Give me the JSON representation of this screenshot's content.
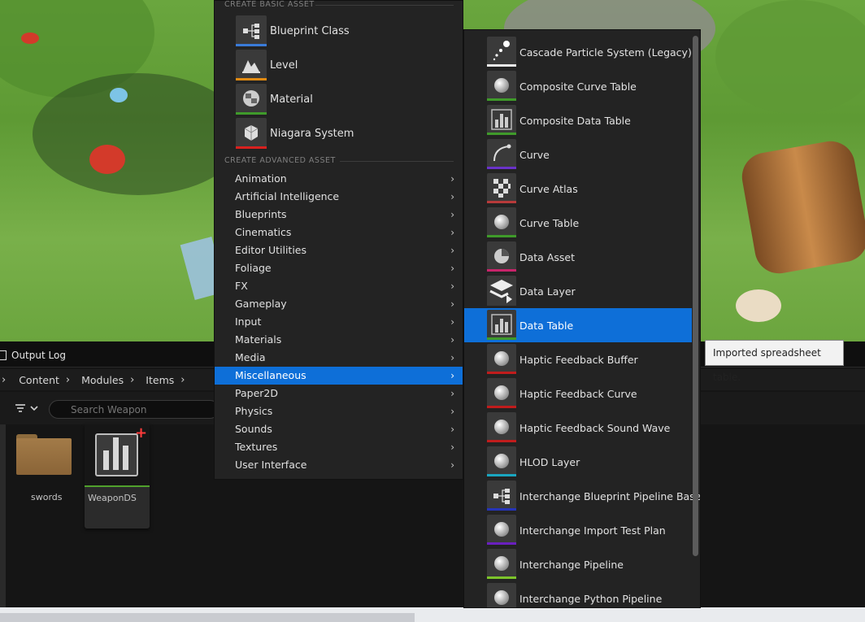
{
  "menu": {
    "section_basic": "CREATE BASIC ASSET",
    "section_advanced": "CREATE ADVANCED ASSET",
    "basic_items": [
      {
        "label": "Blueprint Class",
        "icon": "blueprint-icon",
        "color": "#3a7bd8"
      },
      {
        "label": "Level",
        "icon": "level-icon",
        "color": "#e08a12"
      },
      {
        "label": "Material",
        "icon": "material-icon",
        "color": "#3f9a2a"
      },
      {
        "label": "Niagara System",
        "icon": "niagara-icon",
        "color": "#d8201e"
      }
    ],
    "advanced_items": [
      {
        "label": "Animation"
      },
      {
        "label": "Artificial Intelligence"
      },
      {
        "label": "Blueprints"
      },
      {
        "label": "Cinematics"
      },
      {
        "label": "Editor Utilities"
      },
      {
        "label": "Foliage"
      },
      {
        "label": "FX"
      },
      {
        "label": "Gameplay"
      },
      {
        "label": "Input"
      },
      {
        "label": "Materials"
      },
      {
        "label": "Media"
      },
      {
        "label": "Miscellaneous"
      },
      {
        "label": "Paper2D"
      },
      {
        "label": "Physics"
      },
      {
        "label": "Sounds"
      },
      {
        "label": "Textures"
      },
      {
        "label": "User Interface"
      }
    ],
    "selected": "Miscellaneous"
  },
  "submenu": {
    "items": [
      {
        "label": "Cascade Particle System (Legacy)",
        "icon": "particle-icon",
        "color": "#e8e8e8"
      },
      {
        "label": "Composite Curve Table",
        "icon": "asset-sphere-icon",
        "color": "#3f9a2a"
      },
      {
        "label": "Composite Data Table",
        "icon": "data-table-icon",
        "color": "#3f9a2a"
      },
      {
        "label": "Curve",
        "icon": "curve-icon",
        "color": "#6a32c9"
      },
      {
        "label": "Curve Atlas",
        "icon": "checker-icon",
        "color": "#b83a3a"
      },
      {
        "label": "Curve Table",
        "icon": "asset-sphere-icon",
        "color": "#3f9a2a"
      },
      {
        "label": "Data Asset",
        "icon": "pie-icon",
        "color": "#c8246a"
      },
      {
        "label": "Data Layer",
        "icon": "layers-icon",
        "color": "#3a3a3a"
      },
      {
        "label": "Data Table",
        "icon": "data-table-icon",
        "color": "#3f9a2a"
      },
      {
        "label": "Haptic Feedback Buffer",
        "icon": "asset-sphere-icon",
        "color": "#c01c1c"
      },
      {
        "label": "Haptic Feedback Curve",
        "icon": "asset-sphere-icon",
        "color": "#c01c1c"
      },
      {
        "label": "Haptic Feedback Sound Wave",
        "icon": "asset-sphere-icon",
        "color": "#c01c1c"
      },
      {
        "label": "HLOD Layer",
        "icon": "asset-sphere-icon",
        "color": "#1aa6c0"
      },
      {
        "label": "Interchange Blueprint Pipeline Base",
        "icon": "blueprint-icon",
        "color": "#2634b8"
      },
      {
        "label": "Interchange Import Test Plan",
        "icon": "asset-sphere-icon",
        "color": "#6a1fbf"
      },
      {
        "label": "Interchange Pipeline",
        "icon": "asset-sphere-icon",
        "color": "#7cc42a"
      },
      {
        "label": "Interchange Python Pipeline",
        "icon": "asset-sphere-icon",
        "color": "#3a3a3a"
      }
    ],
    "selected": "Data Table"
  },
  "tooltip": "Imported spreadsheet table.",
  "panel": {
    "tab_title": "Output Log",
    "breadcrumbs": [
      "Content",
      "Modules",
      "Items"
    ],
    "search_placeholder": "Search Weapon",
    "folder_name": "swords",
    "asset_name": "WeaponDS"
  }
}
